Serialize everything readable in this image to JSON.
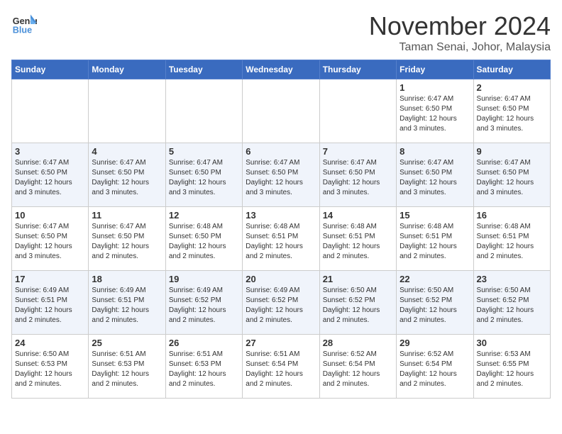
{
  "header": {
    "logo_general": "General",
    "logo_blue": "Blue",
    "month_title": "November 2024",
    "location": "Taman Senai, Johor, Malaysia"
  },
  "weekdays": [
    "Sunday",
    "Monday",
    "Tuesday",
    "Wednesday",
    "Thursday",
    "Friday",
    "Saturday"
  ],
  "rows": [
    [
      {
        "day": "",
        "info": ""
      },
      {
        "day": "",
        "info": ""
      },
      {
        "day": "",
        "info": ""
      },
      {
        "day": "",
        "info": ""
      },
      {
        "day": "",
        "info": ""
      },
      {
        "day": "1",
        "info": "Sunrise: 6:47 AM\nSunset: 6:50 PM\nDaylight: 12 hours and 3 minutes."
      },
      {
        "day": "2",
        "info": "Sunrise: 6:47 AM\nSunset: 6:50 PM\nDaylight: 12 hours and 3 minutes."
      }
    ],
    [
      {
        "day": "3",
        "info": "Sunrise: 6:47 AM\nSunset: 6:50 PM\nDaylight: 12 hours and 3 minutes."
      },
      {
        "day": "4",
        "info": "Sunrise: 6:47 AM\nSunset: 6:50 PM\nDaylight: 12 hours and 3 minutes."
      },
      {
        "day": "5",
        "info": "Sunrise: 6:47 AM\nSunset: 6:50 PM\nDaylight: 12 hours and 3 minutes."
      },
      {
        "day": "6",
        "info": "Sunrise: 6:47 AM\nSunset: 6:50 PM\nDaylight: 12 hours and 3 minutes."
      },
      {
        "day": "7",
        "info": "Sunrise: 6:47 AM\nSunset: 6:50 PM\nDaylight: 12 hours and 3 minutes."
      },
      {
        "day": "8",
        "info": "Sunrise: 6:47 AM\nSunset: 6:50 PM\nDaylight: 12 hours and 3 minutes."
      },
      {
        "day": "9",
        "info": "Sunrise: 6:47 AM\nSunset: 6:50 PM\nDaylight: 12 hours and 3 minutes."
      }
    ],
    [
      {
        "day": "10",
        "info": "Sunrise: 6:47 AM\nSunset: 6:50 PM\nDaylight: 12 hours and 3 minutes."
      },
      {
        "day": "11",
        "info": "Sunrise: 6:47 AM\nSunset: 6:50 PM\nDaylight: 12 hours and 2 minutes."
      },
      {
        "day": "12",
        "info": "Sunrise: 6:48 AM\nSunset: 6:50 PM\nDaylight: 12 hours and 2 minutes."
      },
      {
        "day": "13",
        "info": "Sunrise: 6:48 AM\nSunset: 6:51 PM\nDaylight: 12 hours and 2 minutes."
      },
      {
        "day": "14",
        "info": "Sunrise: 6:48 AM\nSunset: 6:51 PM\nDaylight: 12 hours and 2 minutes."
      },
      {
        "day": "15",
        "info": "Sunrise: 6:48 AM\nSunset: 6:51 PM\nDaylight: 12 hours and 2 minutes."
      },
      {
        "day": "16",
        "info": "Sunrise: 6:48 AM\nSunset: 6:51 PM\nDaylight: 12 hours and 2 minutes."
      }
    ],
    [
      {
        "day": "17",
        "info": "Sunrise: 6:49 AM\nSunset: 6:51 PM\nDaylight: 12 hours and 2 minutes."
      },
      {
        "day": "18",
        "info": "Sunrise: 6:49 AM\nSunset: 6:51 PM\nDaylight: 12 hours and 2 minutes."
      },
      {
        "day": "19",
        "info": "Sunrise: 6:49 AM\nSunset: 6:52 PM\nDaylight: 12 hours and 2 minutes."
      },
      {
        "day": "20",
        "info": "Sunrise: 6:49 AM\nSunset: 6:52 PM\nDaylight: 12 hours and 2 minutes."
      },
      {
        "day": "21",
        "info": "Sunrise: 6:50 AM\nSunset: 6:52 PM\nDaylight: 12 hours and 2 minutes."
      },
      {
        "day": "22",
        "info": "Sunrise: 6:50 AM\nSunset: 6:52 PM\nDaylight: 12 hours and 2 minutes."
      },
      {
        "day": "23",
        "info": "Sunrise: 6:50 AM\nSunset: 6:52 PM\nDaylight: 12 hours and 2 minutes."
      }
    ],
    [
      {
        "day": "24",
        "info": "Sunrise: 6:50 AM\nSunset: 6:53 PM\nDaylight: 12 hours and 2 minutes."
      },
      {
        "day": "25",
        "info": "Sunrise: 6:51 AM\nSunset: 6:53 PM\nDaylight: 12 hours and 2 minutes."
      },
      {
        "day": "26",
        "info": "Sunrise: 6:51 AM\nSunset: 6:53 PM\nDaylight: 12 hours and 2 minutes."
      },
      {
        "day": "27",
        "info": "Sunrise: 6:51 AM\nSunset: 6:54 PM\nDaylight: 12 hours and 2 minutes."
      },
      {
        "day": "28",
        "info": "Sunrise: 6:52 AM\nSunset: 6:54 PM\nDaylight: 12 hours and 2 minutes."
      },
      {
        "day": "29",
        "info": "Sunrise: 6:52 AM\nSunset: 6:54 PM\nDaylight: 12 hours and 2 minutes."
      },
      {
        "day": "30",
        "info": "Sunrise: 6:53 AM\nSunset: 6:55 PM\nDaylight: 12 hours and 2 minutes."
      }
    ]
  ]
}
